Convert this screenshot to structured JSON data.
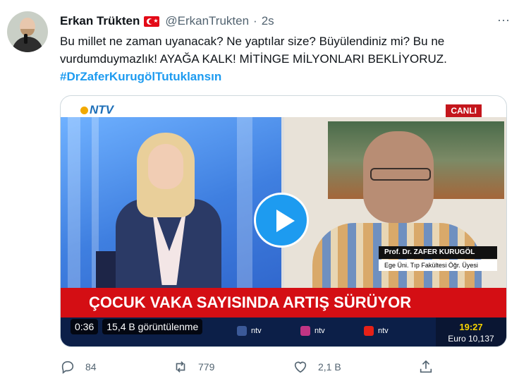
{
  "tweet": {
    "author_name": "Erkan Trükten",
    "handle": "@ErkanTrukten",
    "separator": "·",
    "time": "2s",
    "more": "···",
    "line1": "Bu millet ne zaman uyanacak? Ne yaptılar size? Büyülendiniz mi? Bu ne vurdumduymazlık! AYAĞA KALK! MİTİNGE MİLYONLARI BEKLİYORUZ.",
    "hashtag": "#DrZaferKurugölTutuklansın"
  },
  "media": {
    "channel_logo": "NTV",
    "live_badge": "CANLI",
    "guest_name": "Prof. Dr. ZAFER KURUGÖL",
    "guest_title": "Ege Üni. Tıp Fakültesi Öğr. Üyesi",
    "headline": "ÇOCUK VAKA SAYISINDA ARTIŞ SÜRÜYOR",
    "ticker": [
      {
        "icon": "facebook-icon",
        "label": "ntv",
        "color": "#3b5998"
      },
      {
        "icon": "instagram-icon",
        "label": "ntv",
        "color": "#c13584"
      },
      {
        "icon": "youtube-icon",
        "label": "ntv",
        "color": "#e62117"
      }
    ],
    "clock_time": "19:27",
    "euro": "Euro 10,137",
    "duration": "0:36",
    "views": "15,4 B görüntülenme",
    "play_icon": "play-icon"
  },
  "actions": {
    "replies": "84",
    "retweets": "779",
    "likes": "2,1 B",
    "share_icon": "share-icon"
  },
  "colors": {
    "accent": "#1d9bf0",
    "secondary_text": "#536471",
    "headline_red": "#d40e14",
    "retweet_green": "#00ba7c"
  }
}
